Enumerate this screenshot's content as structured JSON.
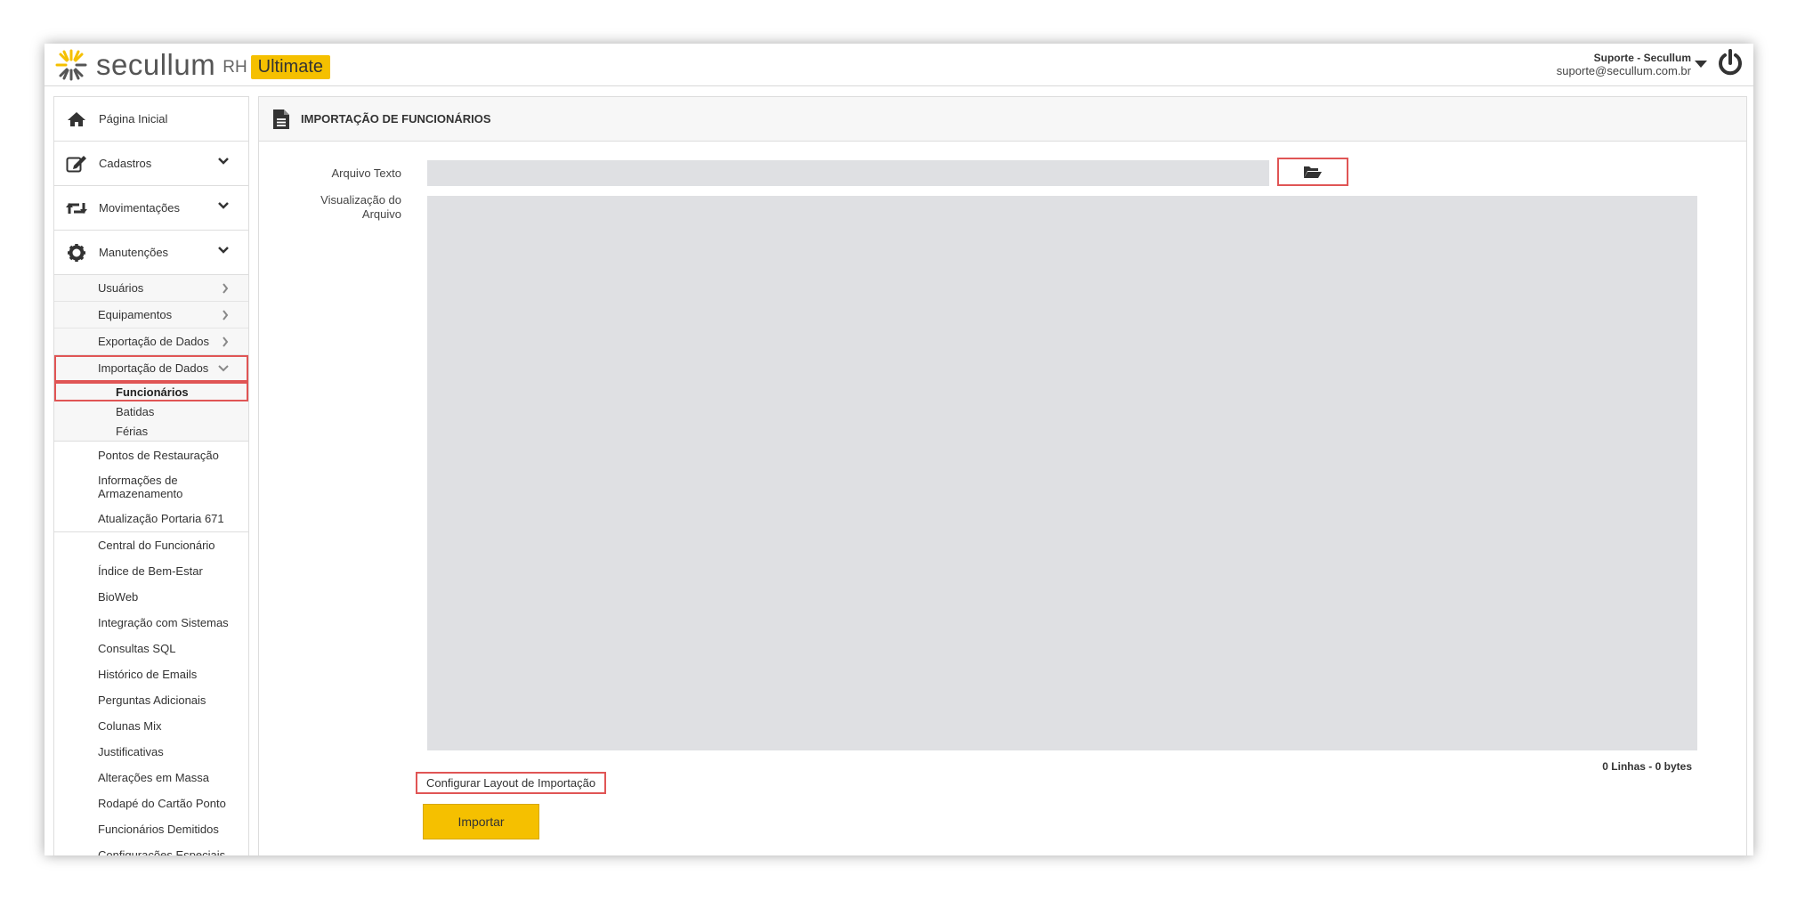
{
  "header": {
    "brand": "secullum",
    "product": "RH",
    "edition": "Ultimate",
    "user_name": "Suporte - Secullum",
    "user_email": "suporte@secullum.com.br",
    "accent_color": "#f5c000"
  },
  "sidebar": {
    "main_items": [
      {
        "label": "Página Inicial",
        "icon": "home-icon"
      },
      {
        "label": "Cadastros",
        "icon": "edit-icon"
      },
      {
        "label": "Movimentações",
        "icon": "retweet-icon"
      },
      {
        "label": "Manutenções",
        "icon": "gear-icon"
      }
    ],
    "sub_items": [
      {
        "label": "Usuários"
      },
      {
        "label": "Equipamentos"
      },
      {
        "label": "Exportação de Dados"
      },
      {
        "label": "Importação de Dados"
      }
    ],
    "import_children": [
      {
        "label": "Funcionários",
        "active": true
      },
      {
        "label": "Batidas"
      },
      {
        "label": "Férias"
      }
    ],
    "plain_group_1": [
      {
        "label": "Pontos de Restauração"
      },
      {
        "label": "Informações de Armazenamento"
      },
      {
        "label": "Atualização Portaria 671"
      }
    ],
    "plain_group_2": [
      {
        "label": "Central do Funcionário"
      },
      {
        "label": "Índice de Bem-Estar"
      },
      {
        "label": "BioWeb"
      },
      {
        "label": "Integração com Sistemas"
      },
      {
        "label": "Consultas SQL"
      },
      {
        "label": "Histórico de Emails"
      },
      {
        "label": "Perguntas Adicionais"
      },
      {
        "label": "Colunas Mix"
      },
      {
        "label": "Justificativas"
      },
      {
        "label": "Alterações em Massa"
      },
      {
        "label": "Rodapé do Cartão Ponto"
      },
      {
        "label": "Funcionários Demitidos"
      },
      {
        "label": "Configurações Especiais"
      }
    ]
  },
  "main": {
    "title": "IMPORTAÇÃO DE FUNCIONÁRIOS",
    "file_label": "Arquivo Texto",
    "file_value": "",
    "preview_label": "Visualização do Arquivo",
    "counts": "0 Linhas - 0 bytes",
    "config_link": "Configurar Layout de Importação",
    "import_button": "Importar"
  }
}
